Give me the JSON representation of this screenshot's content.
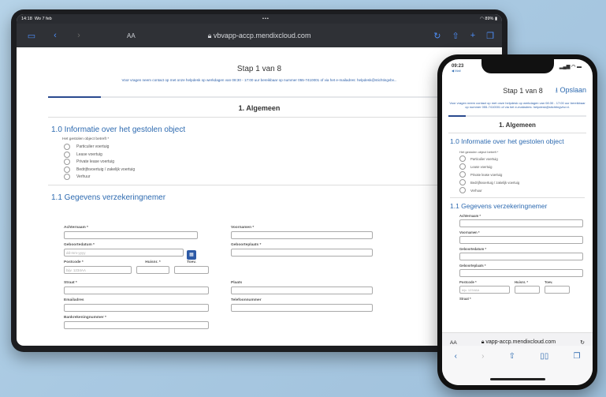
{
  "tablet": {
    "status": {
      "time": "14:18",
      "date": "Wo 7 feb",
      "battery": "89%",
      "dots": "•••"
    },
    "browser": {
      "aa": "AA",
      "url": "vbvapp-accp.mendixcloud.com"
    },
    "page": {
      "step": "Stap 1 van 8",
      "notice": "Voor vragen neem contact op met onze helpdesk op werkdagen van 08:30 - 17:00 uur bereikbaar op nummer 055-7410001 of via het e-mailadres: helpdesk@stichtingvbv...",
      "section": "1. Algemeen",
      "object_heading": "1.0 Informatie over het gestolen object",
      "object_question": "Het gestolen object betreft *",
      "object_options": [
        "Particulier voertuig",
        "Lease voertuig",
        "Private lease voertuig",
        "Bedrijfsvoertuig / zakelijk voertuig",
        "Verhuur"
      ],
      "insured_heading": "1.1 Gegevens verzekeringnemer",
      "fields": {
        "achternaam": "Achternaam *",
        "voornamen": "Voornamen *",
        "geboortedatum": "Geboortedatum *",
        "geboortedatum_ph": "dd-mm-yyyy",
        "geboorteplaats": "Geboorteplaats *",
        "postcode": "Postcode *",
        "postcode_ph": "bijv. 1234AA",
        "huisnr": "Huisnr. *",
        "toev": "Toev.",
        "straat": "Straat *",
        "plaats": "Plaats",
        "emailadres": "Emailadres",
        "telefoon": "Telefoonnummer",
        "bankrekening": "Bankrekeningnummer *"
      }
    }
  },
  "phone": {
    "status": {
      "time": "09:23",
      "back": "◀ Mail"
    },
    "page": {
      "step": "Stap 1 van 8",
      "save": "Opslaan",
      "notice": "Voor vragen neem contact op met onze helpdesk op werkdagen van 08:30 - 17:00 uur bereikbaar op nummer 055-7410001 of via het e-mailadres: helpdesk@stichtingvbv.nl.",
      "section": "1. Algemeen",
      "object_heading": "1.0 Informatie over het gestolen object",
      "object_question": "Het gestolen object betreft *",
      "object_options": [
        "Particulier voertuig",
        "Lease voertuig",
        "Private lease voertuig",
        "Bedrijfsvoertuig / zakelijk voertuig",
        "Verhuur"
      ],
      "insured_heading": "1.1 Gegevens verzekeringnemer",
      "fields": {
        "achternaam": "Achternaam *",
        "voornamen": "Voornamen *",
        "geboortedatum": "Geboortedatum *",
        "geboorteplaats": "Geboorteplaats *",
        "postcode": "Postcode *",
        "postcode_ph": "bijv. 1234AA",
        "huisnr": "Huisnr. *",
        "toev": "Toev.",
        "straat": "Straat *"
      }
    },
    "browser": {
      "aa": "AA",
      "url": "vapp-accp.mendixcloud.com"
    }
  },
  "progress": {
    "step": 1,
    "total": 8,
    "fraction": 0.125
  },
  "colors": {
    "accent": "#2d6ab0",
    "progress": "#2a4a8f",
    "background": "#aecbe3"
  }
}
